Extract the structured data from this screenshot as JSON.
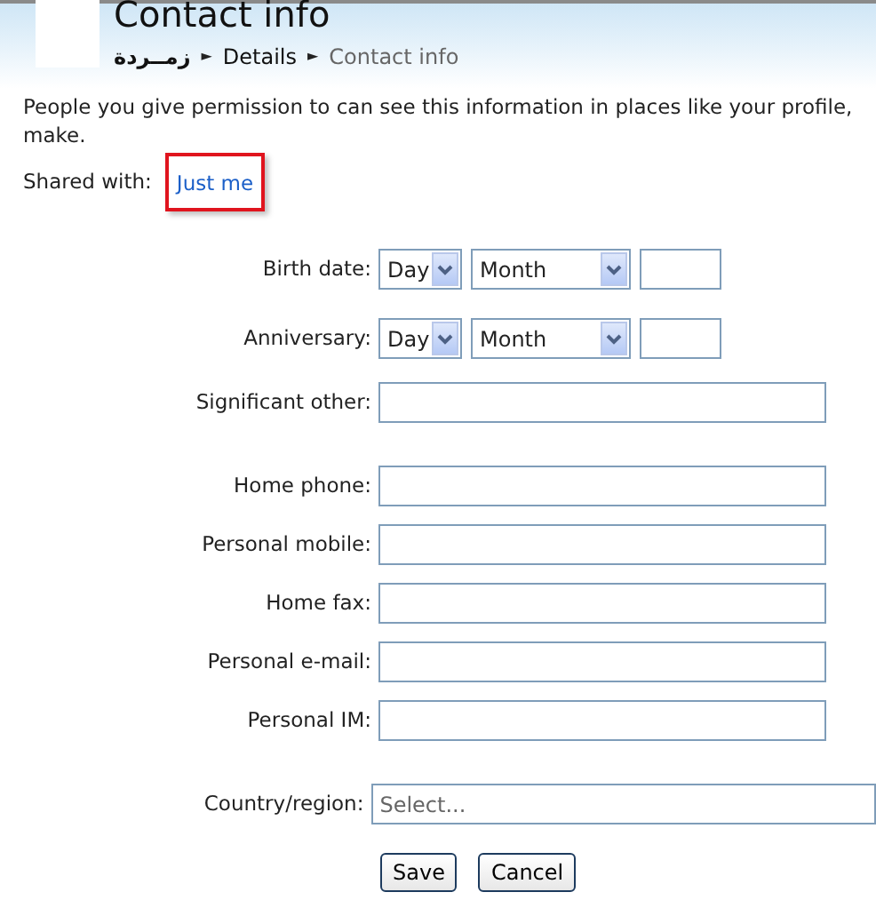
{
  "header": {
    "title": "Contact info",
    "breadcrumb": [
      {
        "label": "زمــردة",
        "current": false
      },
      {
        "label": "Details",
        "current": false
      },
      {
        "label": "Contact info",
        "current": true
      }
    ],
    "separator": "►"
  },
  "intro": [
    "People you give permission to can see this information in places like your profile,",
    "make."
  ],
  "sharing": {
    "label": "Shared with:",
    "link": "Just me",
    "highlighted": true
  },
  "groups": [
    [
      {
        "kind": "date",
        "label": "Birth date:",
        "day": "Day",
        "month": "Month"
      },
      {
        "kind": "date",
        "label": "Anniversary:",
        "day": "Day",
        "month": "Month"
      },
      {
        "kind": "text",
        "label": "Significant other:"
      }
    ],
    [
      {
        "kind": "text",
        "label": "Home phone:"
      },
      {
        "kind": "text",
        "label": "Personal mobile:"
      },
      {
        "kind": "text",
        "label": "Home fax:"
      },
      {
        "kind": "text",
        "label": "Personal e-mail:"
      },
      {
        "kind": "text",
        "label": "Personal IM:"
      }
    ],
    [
      {
        "kind": "select",
        "label": "Country/region:",
        "placeholder": "Select..."
      }
    ]
  ],
  "buttons": [
    "Save",
    "Cancel"
  ]
}
